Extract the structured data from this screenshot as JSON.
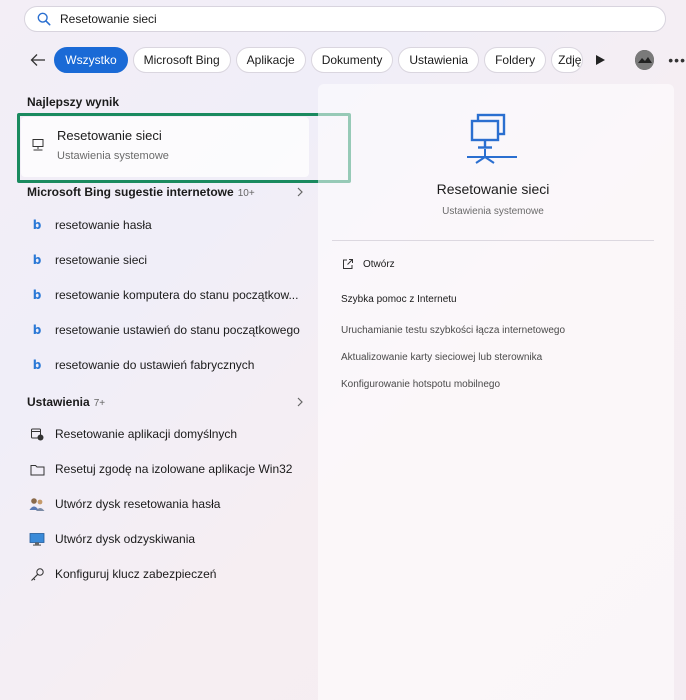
{
  "search": {
    "value": "Resetowanie sieci",
    "icon": "search-icon"
  },
  "filters": {
    "chips": [
      "Wszystko",
      "Microsoft Bing",
      "Aplikacje",
      "Dokumenty",
      "Ustawienia",
      "Foldery",
      "Zdję"
    ],
    "active_index": 0,
    "accent_color": "#1a6ad6"
  },
  "best": {
    "header": "Najlepszy wynik",
    "title": "Resetowanie sieci",
    "subtitle": "Ustawienia systemowe",
    "highlight_color": "#1a8a5f"
  },
  "bing": {
    "header": "Microsoft Bing sugestie internetowe",
    "count": "10+",
    "items": [
      "resetowanie hasła",
      "resetowanie sieci",
      "resetowanie komputera do stanu początkow...",
      "resetowanie ustawień do stanu początkowego",
      "resetowanie do ustawień fabrycznych"
    ]
  },
  "settings": {
    "header": "Ustawienia",
    "count": "7+",
    "items": [
      {
        "label": "Resetowanie aplikacji domyślnych",
        "icon": "default-apps-icon"
      },
      {
        "label": "Resetuj zgodę na izolowane aplikacje Win32",
        "icon": "folder-icon"
      },
      {
        "label": "Utwórz dysk resetowania hasła",
        "icon": "users-icon"
      },
      {
        "label": "Utwórz dysk odzyskiwania",
        "icon": "monitor-icon"
      },
      {
        "label": "Konfiguruj klucz zabezpieczeń",
        "icon": "key-icon"
      }
    ]
  },
  "preview": {
    "title": "Resetowanie sieci",
    "subtitle": "Ustawienia systemowe",
    "open_label": "Otwórz",
    "help_title": "Szybka pomoc z Internetu",
    "help_links": [
      "Uruchamianie testu szybkości łącza internetowego",
      "Aktualizowanie karty sieciowej lub sterownika",
      "Konfigurowanie hotspotu mobilnego"
    ]
  }
}
